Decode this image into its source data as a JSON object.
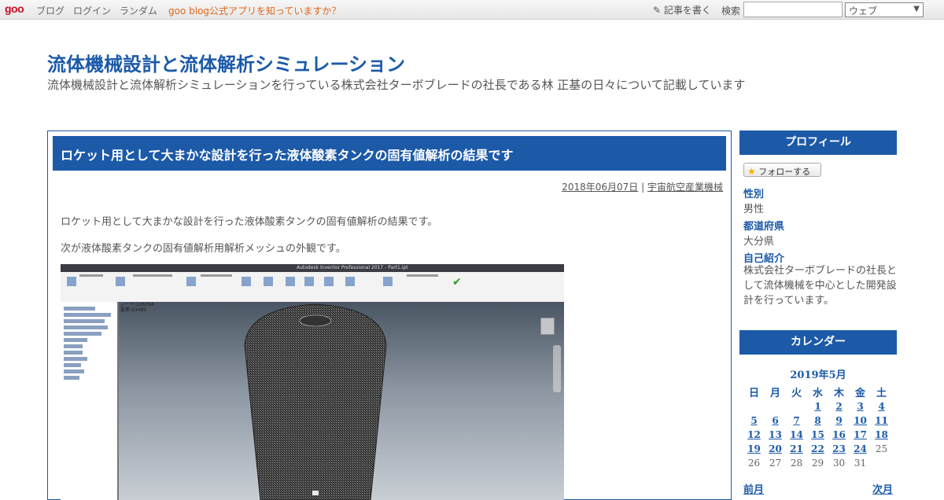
{
  "topbar": {
    "logo": "goo",
    "nav": [
      "ブログ",
      "ログイン",
      "ランダム"
    ],
    "promo": "goo blog公式アプリを知っていますか？",
    "write_label": "記事を書く",
    "search_label": "検索",
    "search_value": "",
    "search_scope": "ウェブ"
  },
  "header": {
    "title": "流体機械設計と流体解析シミュレーション",
    "description": "流体機械設計と流体解析シミュレーションを行っている株式会社ターボブレードの社長である林 正基の日々について記載しています"
  },
  "article": {
    "title": "ロケット用として大まかな設計を行った液体酸素タンクの固有値解析の結果です",
    "date": "2018年06月07日",
    "separator": "|",
    "category": "宇宙航空産業機械",
    "paragraphs": [
      "ロケット用として大まかな設計を行った液体酸素タンクの固有値解析の結果です。",
      "次が液体酸素タンクの固有値解析用解析メッシュの外観です。"
    ],
    "figure": {
      "app_title": "Autodesk Inventor Professional 2017 - Part1.ipt",
      "readout_nodes": "ノード:126294",
      "readout_elements": "要素:63489"
    }
  },
  "sidebar": {
    "profile_heading": "プロフィール",
    "follow_label": "フォローする",
    "profile": [
      {
        "label": "性別",
        "value": "男性"
      },
      {
        "label": "都道府県",
        "value": "大分県"
      },
      {
        "label": "自己紹介",
        "value": "株式会社ターボブレードの社長として流体機械を中心とした開発設計を行っています。"
      }
    ],
    "calendar_heading": "カレンダー",
    "calendar": {
      "month": "2019年5月",
      "weekdays": [
        "日",
        "月",
        "火",
        "水",
        "木",
        "金",
        "土"
      ],
      "weeks": [
        [
          "",
          "",
          "",
          "1",
          "2",
          "3",
          "4"
        ],
        [
          "5",
          "6",
          "7",
          "8",
          "9",
          "10",
          "11"
        ],
        [
          "12",
          "13",
          "14",
          "15",
          "16",
          "17",
          "18"
        ],
        [
          "19",
          "20",
          "21",
          "22",
          "23",
          "24",
          "25"
        ],
        [
          "26",
          "27",
          "28",
          "29",
          "30",
          "31",
          ""
        ]
      ],
      "linked_days": [
        "1",
        "2",
        "3",
        "4",
        "5",
        "6",
        "7",
        "8",
        "9",
        "10",
        "11",
        "12",
        "13",
        "14",
        "15",
        "16",
        "17",
        "18",
        "19",
        "20",
        "21",
        "22",
        "23",
        "24"
      ],
      "prev_label": "前月",
      "next_label": "次月"
    }
  },
  "colors": {
    "accent": "#1c5aa8",
    "promo": "#e0681a",
    "logo": "#c30d23"
  }
}
